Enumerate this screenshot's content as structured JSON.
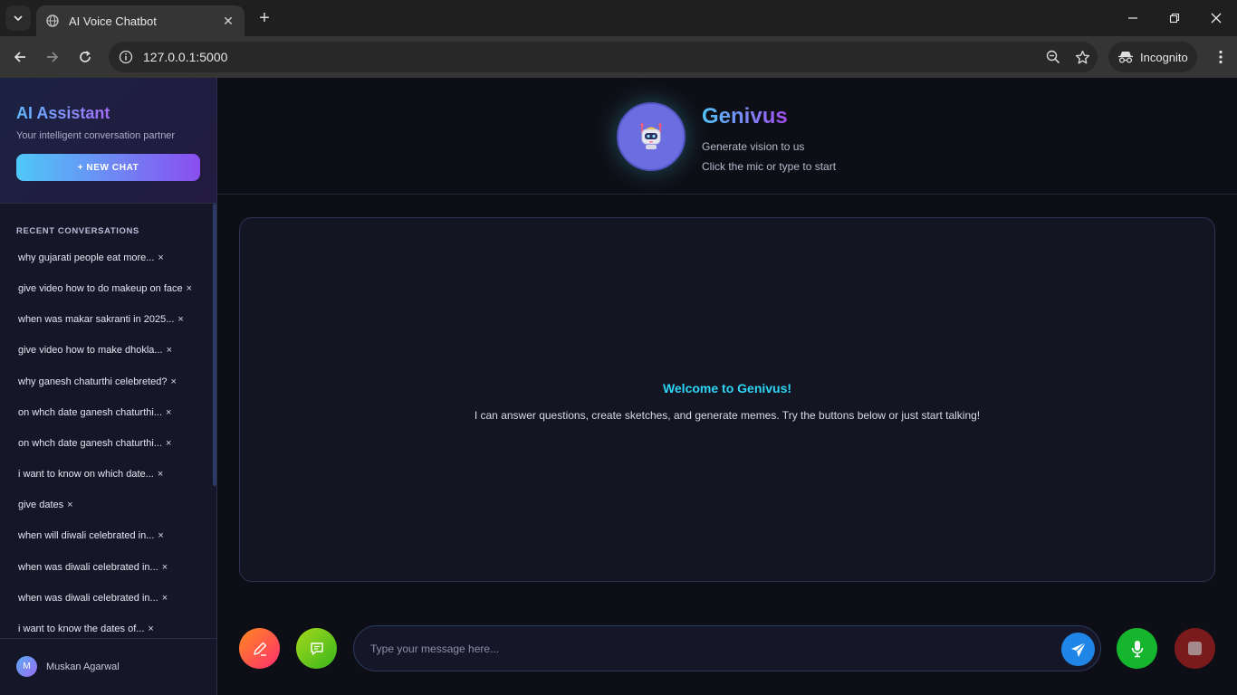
{
  "browser": {
    "tab_title": "AI Voice Chatbot",
    "tab_close": "✕",
    "new_tab": "+",
    "url": "127.0.0.1:5000",
    "incognito_label": "Incognito"
  },
  "sidebar": {
    "title": "AI Assistant",
    "subtitle": "Your intelligent conversation partner",
    "new_chat_label": "+ NEW CHAT",
    "section_title": "RECENT CONVERSATIONS",
    "delete_glyph": "×",
    "conversations": [
      "why gujarati people eat more...",
      "give video how to do makeup on face",
      "when was makar sakranti in 2025...",
      "give video how to make dhokla...",
      "why ganesh chaturthi celebreted?",
      "on whch date ganesh chaturthi...",
      "on whch date ganesh chaturthi...",
      "i want to know on which date...",
      "give dates",
      "when will diwali celebrated in...",
      "when was diwali celebrated in...",
      "when was diwali celebrated in...",
      "i want to know the dates of..."
    ],
    "user": {
      "initial": "M",
      "name": "Muskan Agarwal"
    }
  },
  "header": {
    "brand": "Genivus",
    "tagline": "Generate vision to us",
    "hint": "Click the mic or type to start"
  },
  "chat": {
    "welcome_title": "Welcome to Genivus!",
    "welcome_text": "I can answer questions, create sketches, and generate memes. Try the buttons below or just start talking!"
  },
  "input": {
    "placeholder": "Type your message here...",
    "value": ""
  },
  "colors": {
    "accent_cyan": "#2ed6f5",
    "accent_purple": "#a34cf0",
    "send": "#1f86e8",
    "mic": "#16b52e",
    "stop": "#7a1a1c"
  },
  "icons": {
    "sketch": "pencil-icon",
    "meme": "chat-bubble-icon",
    "send": "paper-plane-icon",
    "mic": "microphone-icon",
    "stop": "stop-icon"
  }
}
